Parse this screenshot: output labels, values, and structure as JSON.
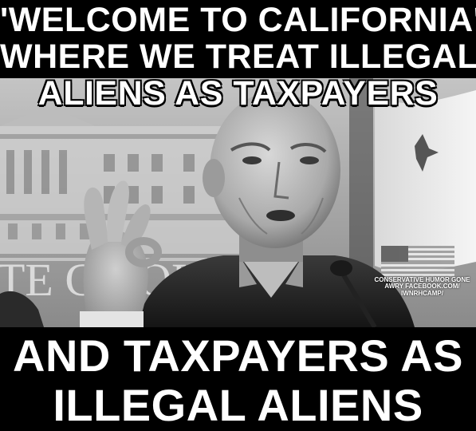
{
  "caption_top": {
    "line1": "'WELCOME TO CALIFORNIA'",
    "line2": "WHERE WE TREAT ILLEGAL",
    "line3": "ALIENS AS TAXPAYERS"
  },
  "caption_bottom": {
    "line1": "AND TAXPAYERS AS",
    "line2": "ILLEGAL ALIENS"
  },
  "background_sign_text": "TE CA    OL",
  "watermark": {
    "line1": "CONSERVATIVE HUMOR GONE",
    "line2": "AWRY FACEBOOK.COM/",
    "line3": "IWNRHCAMP/"
  },
  "colors": {
    "background": "#000000",
    "caption_text": "#ffffff"
  }
}
